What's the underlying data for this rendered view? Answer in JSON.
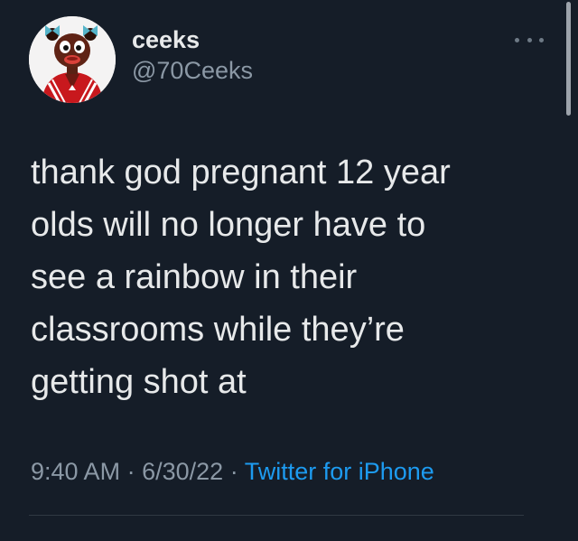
{
  "author": {
    "display_name": "ceeks",
    "handle": "@70Ceeks",
    "avatar_icon": "cartoon-avatar"
  },
  "tweet": {
    "text": "thank god pregnant 12 year\nolds will no longer have to\nsee a rainbow in their\nclassrooms while they’re\ngetting shot at",
    "time": "9:40 AM",
    "date": "6/30/22",
    "separator": "·",
    "source": "Twitter for iPhone"
  },
  "colors": {
    "background": "#151d28",
    "text": "#e7e9ea",
    "secondary_text": "#8b98a5",
    "link": "#1d9bf0"
  }
}
